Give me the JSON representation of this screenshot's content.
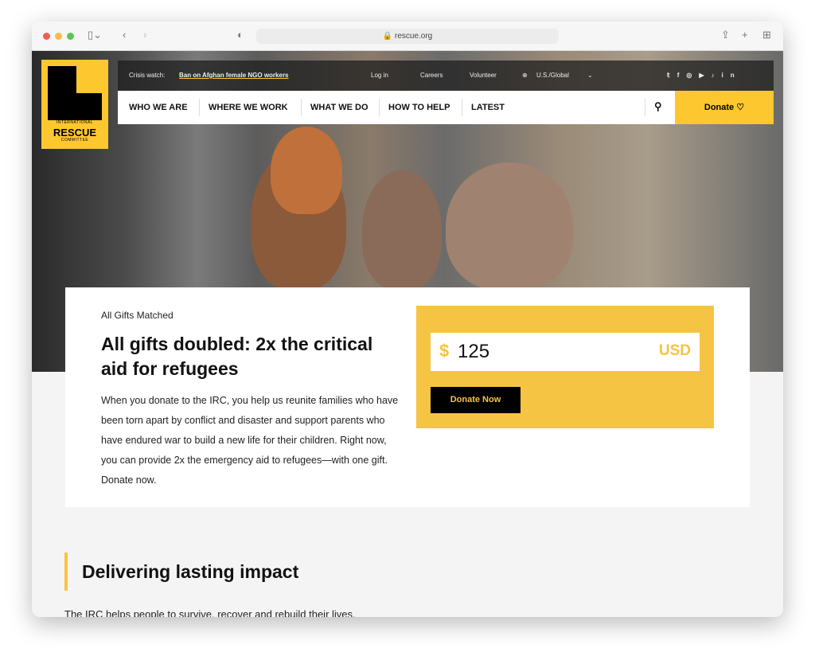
{
  "browser": {
    "url": "rescue.org"
  },
  "logo": {
    "line1": "INTERNATIONAL",
    "line2": "RESCUE",
    "line3": "COMMITTEE"
  },
  "utility": {
    "crisis_label": "Crisis watch:",
    "crisis_link": "Ban on Afghan female NGO workers",
    "login": "Log in",
    "careers": "Careers",
    "volunteer": "Volunteer",
    "region": "U.S./Global"
  },
  "nav": {
    "items": [
      "WHO WE ARE",
      "WHERE WE WORK",
      "WHAT WE DO",
      "HOW TO HELP",
      "LATEST"
    ],
    "donate": "Donate"
  },
  "card": {
    "eyebrow": "All Gifts Matched",
    "title": "All gifts doubled: 2x the critical aid for refugees",
    "body": "When you donate to the IRC, you help us reunite families who have been torn apart by conflict and disaster and support parents who have endured war to build a new life for their children. Right now, you can provide 2x the emergency aid to refugees—with one gift. Donate now."
  },
  "donation": {
    "currency_symbol": "$",
    "amount": "125",
    "currency": "USD",
    "button": "Donate Now"
  },
  "section": {
    "title": "Delivering lasting impact",
    "subtitle": "The IRC helps people to survive, recover and rebuild their lives."
  },
  "colors": {
    "brand_yellow": "#fdc82f",
    "black": "#000000"
  }
}
